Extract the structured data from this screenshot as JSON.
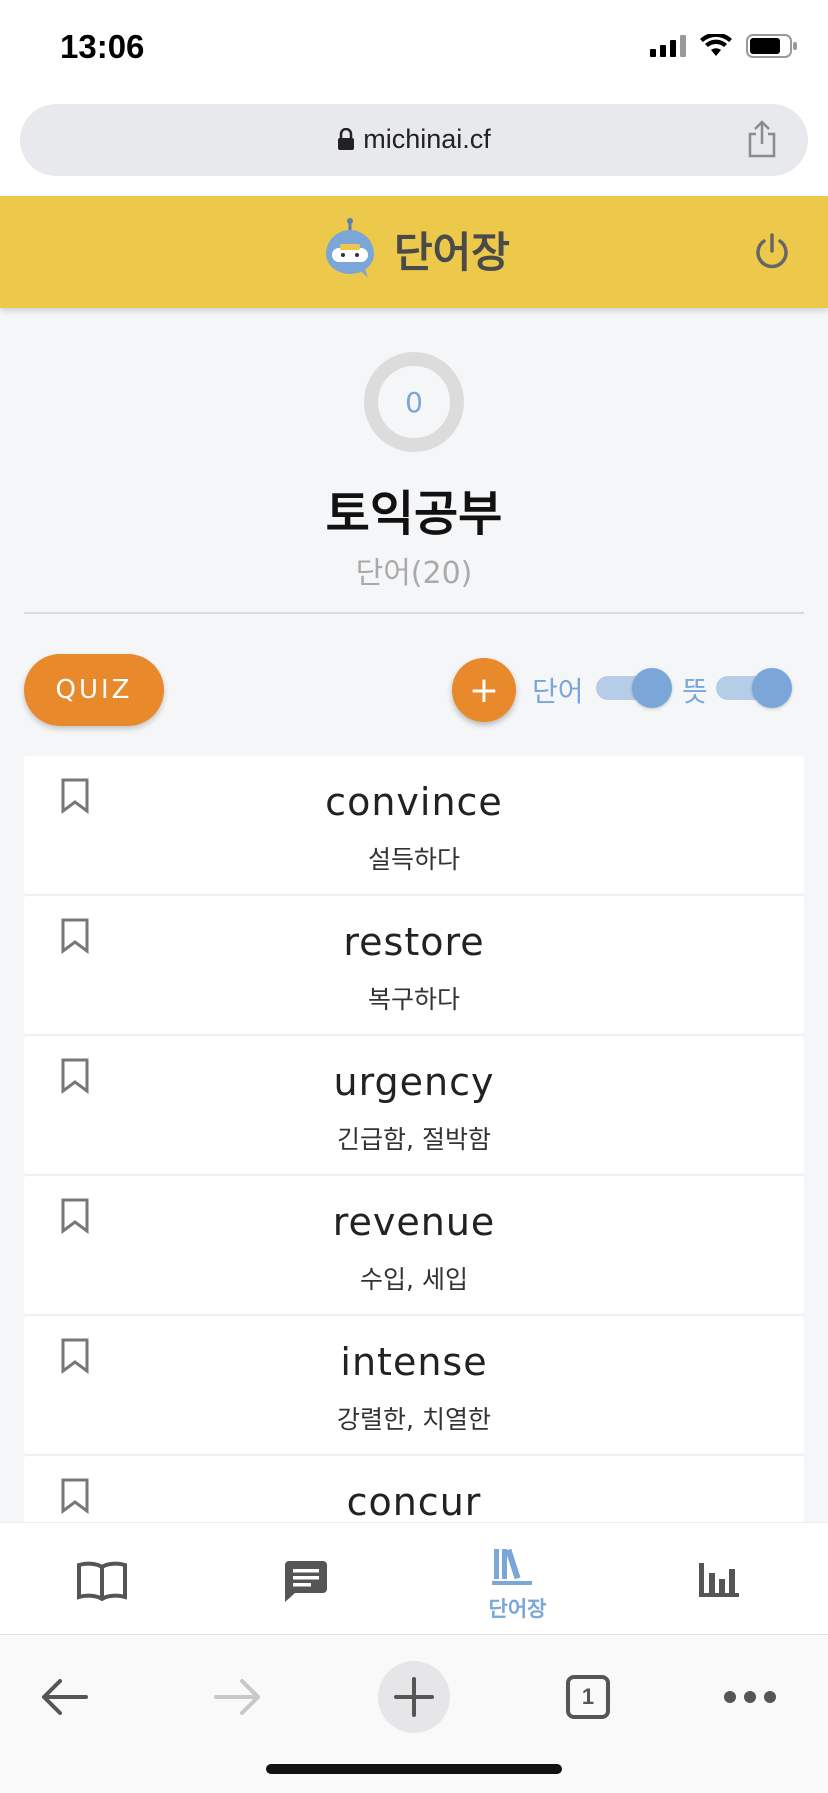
{
  "status_bar": {
    "time": "13:06"
  },
  "browser": {
    "url": "michinai.cf",
    "tab_count": "1"
  },
  "header": {
    "title": "단어장"
  },
  "vocab_set": {
    "count": "0",
    "title": "토익공부",
    "subtitle": "단어(20)"
  },
  "controls": {
    "quiz_label": "QUIZ",
    "add_label": "+",
    "toggles": [
      {
        "label": "단어",
        "on": true
      },
      {
        "label": "뜻",
        "on": true
      }
    ]
  },
  "words": [
    {
      "word": "convince",
      "meaning": "설득하다"
    },
    {
      "word": "restore",
      "meaning": "복구하다"
    },
    {
      "word": "urgency",
      "meaning": "긴급함, 절박함"
    },
    {
      "word": "revenue",
      "meaning": "수입, 세입"
    },
    {
      "word": "intense",
      "meaning": "강렬한, 치열한"
    },
    {
      "word": "concur",
      "meaning": ""
    }
  ],
  "bottom_nav": {
    "items": [
      {
        "icon": "book-icon",
        "label": ""
      },
      {
        "icon": "chat-icon",
        "label": ""
      },
      {
        "icon": "library-icon",
        "label": "단어장",
        "active": true
      },
      {
        "icon": "chart-icon",
        "label": ""
      }
    ]
  },
  "colors": {
    "header_bg": "#ecc94b",
    "accent_orange": "#e8892c",
    "accent_blue": "#7aa6d8"
  }
}
